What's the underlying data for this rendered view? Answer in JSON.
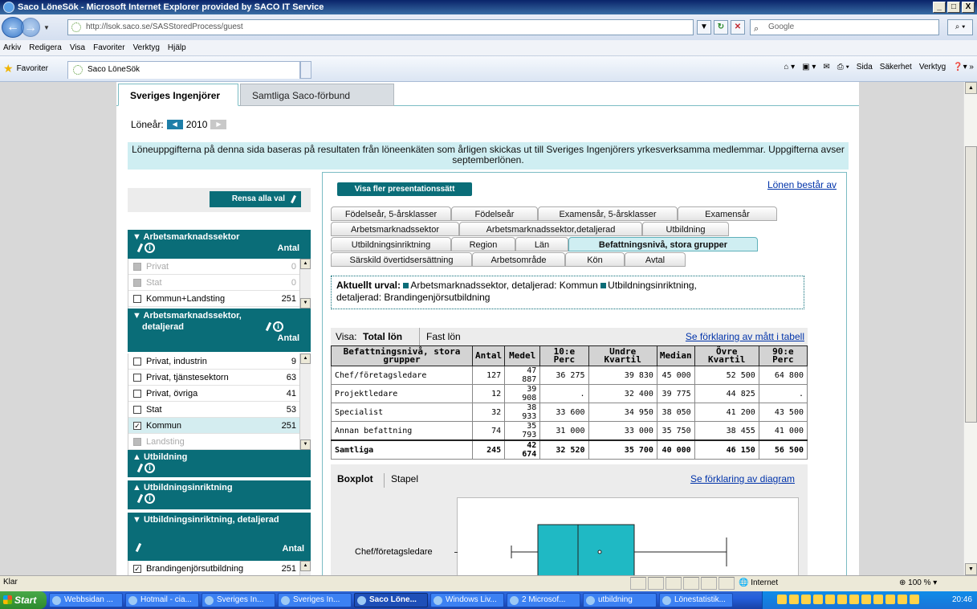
{
  "window": {
    "title": "Saco LöneSök - Microsoft Internet Explorer provided by SACO IT Service",
    "buttons": [
      "_",
      "□",
      "X"
    ]
  },
  "address": {
    "url": "http://lsok.saco.se/SASStoredProcess/guest",
    "search_placeholder": "Google"
  },
  "menu": [
    "Arkiv",
    "Redigera",
    "Visa",
    "Favoriter",
    "Verktyg",
    "Hjälp"
  ],
  "favbar": {
    "favorites": "Favoriter",
    "tab": "Saco LöneSök",
    "commands": [
      "Sida",
      "Säkerhet",
      "Verktyg"
    ]
  },
  "page": {
    "tabs": [
      {
        "label": "Sveriges Ingenjörer",
        "active": true
      },
      {
        "label": "Samtliga Saco-förbund",
        "active": false
      }
    ],
    "year_label": "Löneår:",
    "year_value": "2010",
    "info": "Löneuppgifterna på denna sida baseras på resultaten från löneenkäten som årligen skickas ut till Sveriges Ingenjörers yrkesverksamma medlemmar. Uppgifterna avser septemberlönen.",
    "rensa": "Rensa alla val",
    "antal": "Antal",
    "groups": {
      "g1": "▼ Arbetsmarknadssektor",
      "g1_items": [
        {
          "label": "Privat",
          "count": "0",
          "state": "dim"
        },
        {
          "label": "Stat",
          "count": "0",
          "state": "dim"
        },
        {
          "label": "Kommun+Landsting",
          "count": "251",
          "state": "normal"
        }
      ],
      "g2a": "▼ Arbetsmarknadssektor,",
      "g2b": "detaljerad",
      "g2_items": [
        {
          "label": "Privat, industrin",
          "count": "9",
          "state": "normal",
          "checked": ""
        },
        {
          "label": "Privat, tjänstesektorn",
          "count": "63",
          "state": "normal",
          "checked": ""
        },
        {
          "label": "Privat, övriga",
          "count": "41",
          "state": "normal",
          "checked": ""
        },
        {
          "label": "Stat",
          "count": "53",
          "state": "normal",
          "checked": ""
        },
        {
          "label": "Kommun",
          "count": "251",
          "state": "sel",
          "checked": "✓"
        },
        {
          "label": "Landsting",
          "count": "",
          "state": "dim",
          "checked": ""
        }
      ],
      "g3": "▲ Utbildning",
      "g4": "▲ Utbildningsinriktning",
      "g5": "▼ Utbildningsinriktning, detaljerad",
      "g5_item": {
        "label": "Brandingenjörsutbildning",
        "count": "251",
        "checked": "✓"
      }
    },
    "visa_fler": "Visa fler presentationssätt",
    "lonen": "Lönen består av",
    "ftabs": {
      "row1": [
        "Födelseår, 5-årsklasser",
        "Födelseår",
        "Examensår, 5-årsklasser",
        "Examensår"
      ],
      "row2": [
        "Arbetsmarknadssektor",
        "Arbetsmarknadssektor,detaljerad",
        "Utbildning"
      ],
      "row3": [
        "Utbildningsinriktning",
        "Region",
        "Län",
        "Befattningsnivå, stora grupper"
      ],
      "row4": [
        "Särskild övertidsersättning",
        "Arbetsområde",
        "Kön",
        "Avtal"
      ]
    },
    "urval_label": "Aktuellt urval:",
    "urval_1": "Arbetsmarknadssektor, detaljerad: Kommun",
    "urval_2": "Utbildningsinriktning,",
    "urval_3": "detaljerad: Brandingenjörsutbildning",
    "visa": "Visa:",
    "total_lon": "Total lön",
    "fast_lon": "Fast lön",
    "se_matt": "Se förklaring av mått i tabell",
    "table": {
      "headers": [
        "Befattningsnivå, stora grupper",
        "Antal",
        "Medel",
        "10:e Perc",
        "Undre Kvartil",
        "Median",
        "Övre Kvartil",
        "90:e Perc"
      ],
      "rows": [
        [
          "Chef/företagsledare",
          "127",
          "47 887",
          "36 275",
          "39 830",
          "45 000",
          "52 500",
          "64 800"
        ],
        [
          "Projektledare",
          "12",
          "39 908",
          ".",
          "32 400",
          "39 775",
          "44 825",
          "."
        ],
        [
          "Specialist",
          "32",
          "38 933",
          "33 600",
          "34 950",
          "38 050",
          "41 200",
          "43 500"
        ],
        [
          "Annan befattning",
          "74",
          "35 793",
          "31 000",
          "33 000",
          "35 750",
          "38 455",
          "41 000"
        ]
      ],
      "total": [
        "Samtliga",
        "245",
        "42 674",
        "32 520",
        "35 700",
        "40 000",
        "46 150",
        "56 500"
      ]
    },
    "boxplot": "Boxplot",
    "stapel": "Stapel",
    "se_diagram": "Se förklaring av diagram",
    "chart_label": "Chef/företagsledare"
  },
  "status": {
    "left": "Klar",
    "zone": "Internet",
    "zoom": "100 %"
  },
  "taskbar": {
    "start": "Start",
    "items": [
      "Webbsidan ...",
      "Hotmail - cia...",
      "Sveriges In...",
      "Sveriges In...",
      "Saco Löne...",
      "Windows Liv...",
      "2 Microsof...",
      "utbildning",
      "Lönestatistik..."
    ],
    "clock": "20:46"
  },
  "colors": {
    "teal": "#0a6d78",
    "light_teal": "#cfeef2",
    "box": "#1fb9c4"
  }
}
